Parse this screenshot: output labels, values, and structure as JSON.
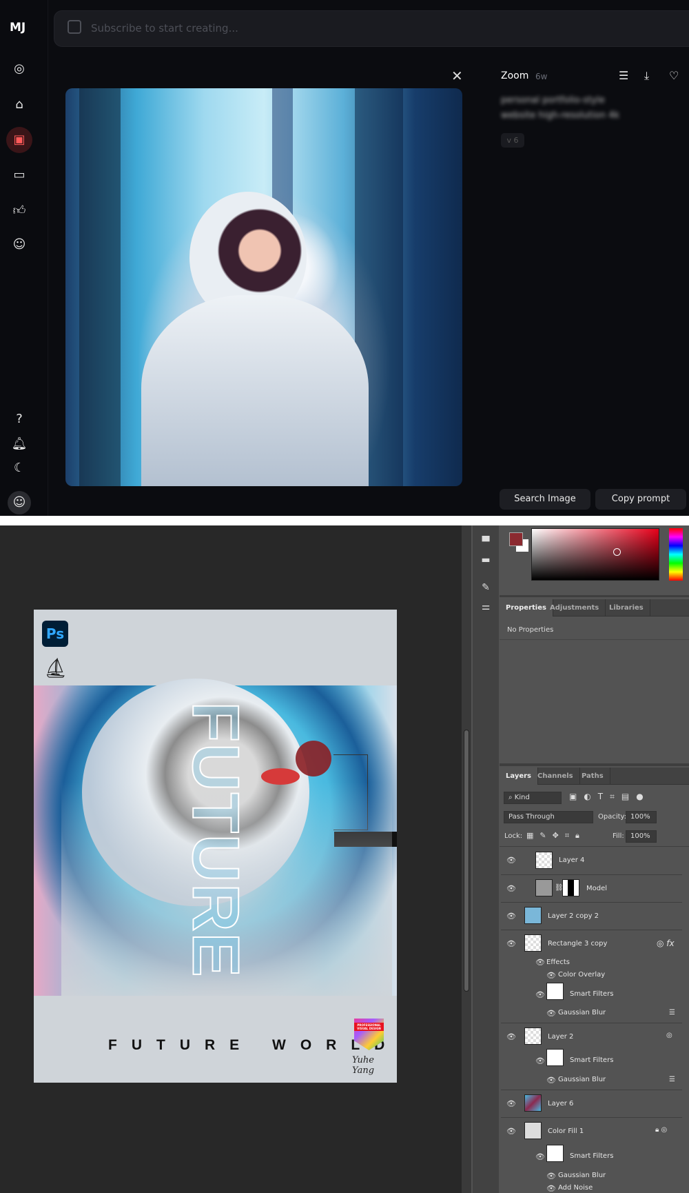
{
  "midjourney": {
    "logo": "MJ",
    "search_placeholder": "Subscribe to start creating...",
    "sidebar_icons": [
      "compass-icon",
      "brush-icon",
      "image-icon",
      "chat-icon",
      "thumbs-up-icon",
      "profile-icon",
      "help-icon",
      "bell-icon",
      "moon-icon",
      "account-icon"
    ],
    "active_icon": "image-icon",
    "panel": {
      "title": "Zoom",
      "age": "6w",
      "prompt_line1": "personal portfolio-style",
      "prompt_line2": "website high-resolution 4k",
      "version": "v 6",
      "search_button": "Search Image",
      "copy_button": "Copy prompt"
    }
  },
  "photoshop": {
    "foreground_color": "#8b2a30",
    "background_color": "#ffffff",
    "properties_tabs": [
      "Properties",
      "Adjustments",
      "Libraries"
    ],
    "no_properties": "No Properties",
    "layer_tabs": [
      "Layers",
      "Channels",
      "Paths"
    ],
    "filter_kind": "Kind",
    "blend_mode": "Pass Through",
    "opacity_label": "Opacity:",
    "opacity": "100%",
    "lock_label": "Lock:",
    "fill_label": "Fill:",
    "fill": "100%",
    "layers": [
      "Layer 4",
      "Model",
      "Layer 2 copy 2",
      "Rectangle 3 copy",
      "Effects",
      "Color Overlay",
      "Smart Filters",
      "Gaussian Blur",
      "Layer 2",
      "Smart Filters",
      "Gaussian Blur",
      "Layer 6",
      "Color Fill 1",
      "Smart Filters",
      "Gaussian Blur",
      "Add Noise"
    ],
    "poster": {
      "title_vertical": "FUTURE",
      "subtitle": "FUTURE WORLD",
      "badge": "PROFESSIONAL VISUAL DESIGN",
      "app_logo": "Ps",
      "signature": "Yuhe Yang"
    }
  }
}
